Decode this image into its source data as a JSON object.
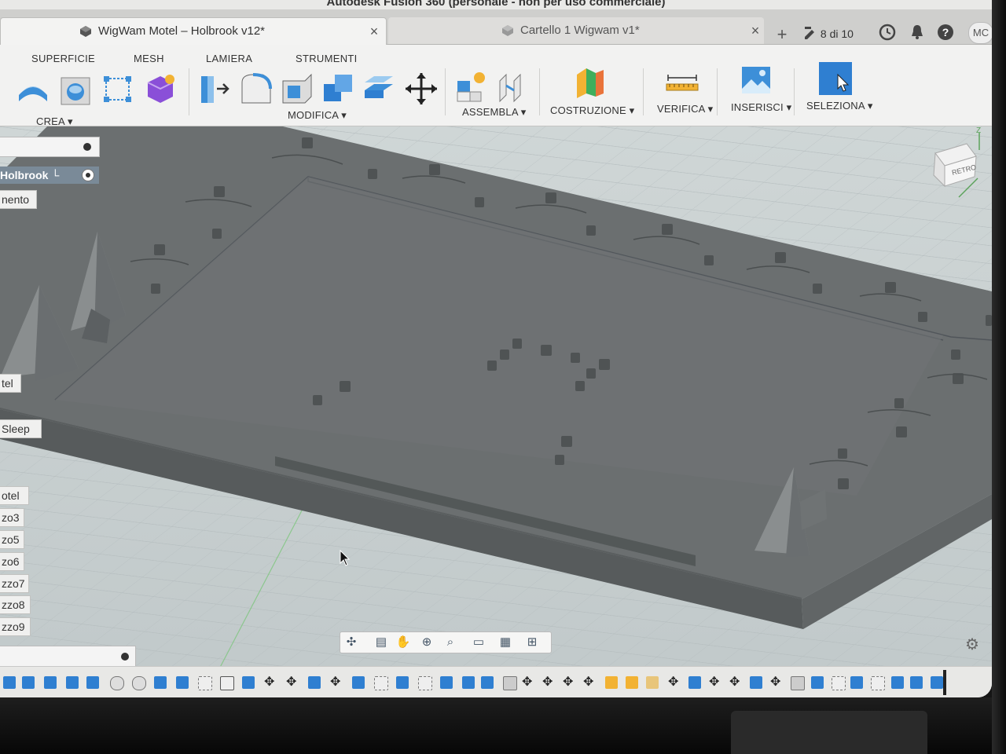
{
  "window": {
    "title": "Autodesk Fusion 360 (personale - non per uso commerciale)"
  },
  "tabs": [
    {
      "label": "WigWam Motel – Holbrook v12*",
      "active": true
    },
    {
      "label": "Cartello 1 Wigwam v1*",
      "active": false
    }
  ],
  "header": {
    "job_status": "8 di 10",
    "user_initials": "MC"
  },
  "toolbar": {
    "tabs": [
      "SUPERFICIE",
      "MESH",
      "LAMIERA",
      "STRUMENTI"
    ],
    "groups": {
      "crea": "CREA ▾",
      "modifica": "MODIFICA ▾",
      "assembla": "ASSEMBLA ▾",
      "costruzione": "COSTRUZIONE ▾",
      "verifica": "VERIFICA ▾",
      "inserisci": "INSERISCI ▾",
      "seleziona": "SELEZIONA ▾"
    }
  },
  "browser": {
    "root": "Holbrook └",
    "items": [
      "nento",
      "tel",
      "Sleep",
      "otel",
      "zo3",
      "zo5",
      "zo6",
      "zzo7",
      "zzo8",
      "zzo9"
    ]
  },
  "viewcube": {
    "face_label": "RETRO",
    "axis": "Z"
  },
  "colors": {
    "accent_blue": "#2f7fd1",
    "model_gray": "#6b6f70",
    "grid_bg": "#c9d0d1",
    "toolbar_bg": "#f2f2f1"
  }
}
